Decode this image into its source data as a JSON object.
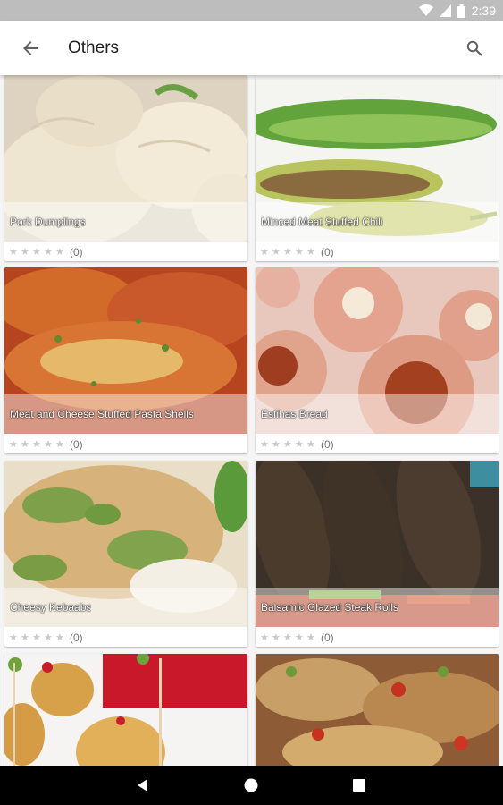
{
  "status_bar": {
    "time": "2:39",
    "icons": [
      "wifi-icon",
      "cellular-signal-icon",
      "battery-icon"
    ]
  },
  "app_bar": {
    "title": "Others",
    "back_icon": "arrow-back-icon",
    "search_icon": "search-icon"
  },
  "recipes": [
    {
      "title": "Pork Dumplings",
      "rating_count": "(0)",
      "stars": 0
    },
    {
      "title": "Minced Meat Stuffed Chili",
      "rating_count": "(0)",
      "stars": 0
    },
    {
      "title": "Meat and Cheese Stuffed Pasta Shells",
      "rating_count": "(0)",
      "stars": 0
    },
    {
      "title": "Esfihas Bread",
      "rating_count": "(0)",
      "stars": 0
    },
    {
      "title": "Cheesy Kebaabs",
      "rating_count": "(0)",
      "stars": 0
    },
    {
      "title": "Balsamic Glazed Steak Rolls",
      "rating_count": "(0)",
      "stars": 0
    },
    {
      "title": "",
      "rating_count": "",
      "stars": 0
    },
    {
      "title": "",
      "rating_count": "",
      "stars": 0
    }
  ],
  "nav_bar": {
    "icons": [
      "nav-back-icon",
      "nav-home-icon",
      "nav-recents-icon"
    ]
  },
  "colors": {
    "app_bar_bg": "#ffffff",
    "status_bar_bg": "#bdbdbd",
    "star_empty": "#c8c8c8",
    "nav_bar_bg": "#000000"
  }
}
